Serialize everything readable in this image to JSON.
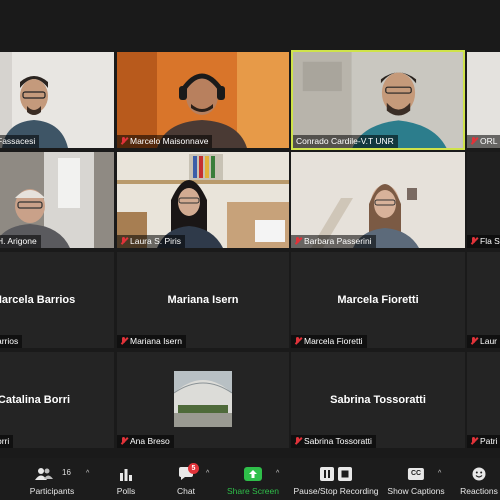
{
  "participants": [
    {
      "label": "Fassacesi",
      "big": ""
    },
    {
      "label": "Marcelo Maisonnave",
      "big": ""
    },
    {
      "label": "Conrado Cardile-V.T UNR",
      "big": ""
    },
    {
      "label": "ORL",
      "big": ""
    },
    {
      "label": "H. Arigone",
      "big": ""
    },
    {
      "label": "Laura S. Piris",
      "big": ""
    },
    {
      "label": "Barbara Passerini",
      "big": ""
    },
    {
      "label": "Fla S",
      "big": ""
    },
    {
      "label": "arrios",
      "big": "Marcela Barrios"
    },
    {
      "label": "Mariana Isern",
      "big": "Mariana Isern"
    },
    {
      "label": "Marcela Fioretti",
      "big": "Marcela Fioretti"
    },
    {
      "label": "Laur",
      "big": ""
    },
    {
      "label": "orri",
      "big": "Catalina Borri"
    },
    {
      "label": "Ana Breso",
      "big": ""
    },
    {
      "label": "Sabrina Tossoratti",
      "big": "Sabrina Tossoratti"
    },
    {
      "label": "Patri",
      "big": ""
    }
  ],
  "toolbar": {
    "participants_label": "Participants",
    "participants_count": "16",
    "polls_label": "Polls",
    "chat_label": "Chat",
    "chat_badge": "5",
    "share_label": "Share Screen",
    "record_label": "Pause/Stop Recording",
    "captions_label": "Show Captions",
    "captions_icon_text": "CC",
    "reactions_label": "Reactions"
  },
  "colors": {
    "speaking_border": "#cfe34a",
    "share_green": "#2fbf4a",
    "muted_red": "#e0333a"
  }
}
